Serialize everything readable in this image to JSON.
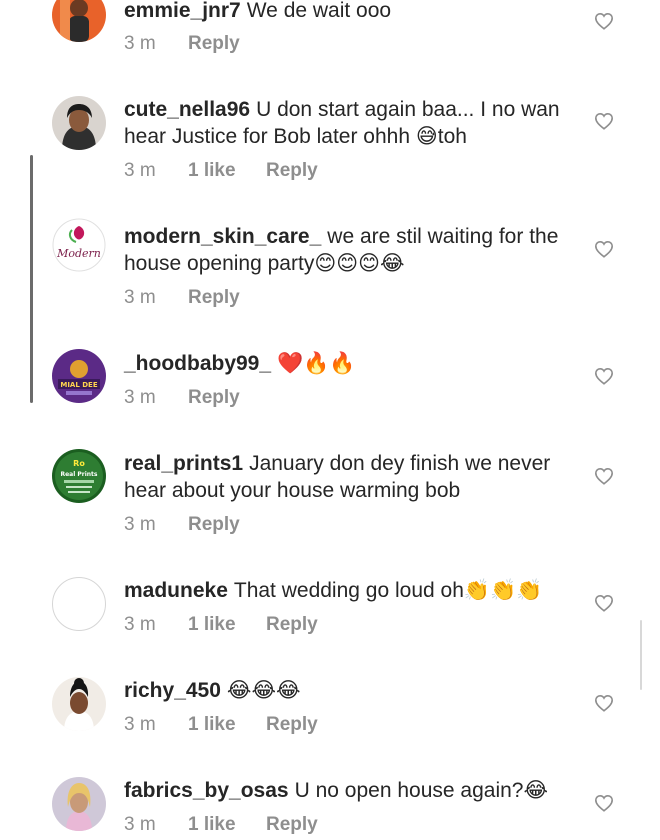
{
  "comments": [
    {
      "username": "emmie_jnr7",
      "text": "We de wait ooo",
      "time": "3 m",
      "likes": "",
      "reply": "Reply",
      "avatar": "orange-photo"
    },
    {
      "username": "cute_nella96",
      "text": "U don start again baa... I no wan hear Justice for Bob later ohhh 😅toh",
      "time": "3 m",
      "likes": "1 like",
      "reply": "Reply",
      "avatar": "woman-photo"
    },
    {
      "username": "modern_skin_care_",
      "text": "we are stil waiting for the house opening party😊😊😊😂",
      "time": "3 m",
      "likes": "",
      "reply": "Reply",
      "avatar": "modern-logo"
    },
    {
      "username": "_hoodbaby99_",
      "text": "❤️🔥🔥",
      "time": "3 m",
      "likes": "",
      "reply": "Reply",
      "avatar": "purple-badge"
    },
    {
      "username": "real_prints1",
      "text": "January don dey finish we never hear about your house warming bob",
      "time": "3 m",
      "likes": "",
      "reply": "Reply",
      "avatar": "real-prints-logo"
    },
    {
      "username": "maduneke",
      "text": "That wedding go loud oh👏👏👏",
      "time": "3 m",
      "likes": "1 like",
      "reply": "Reply",
      "avatar": "empty"
    },
    {
      "username": "richy_450",
      "text": "😂😂😂",
      "time": "3 m",
      "likes": "1 like",
      "reply": "Reply",
      "avatar": "woman-photo-2"
    },
    {
      "username": "fabrics_by_osas",
      "text": "U no open house again?😂",
      "time": "3 m",
      "likes": "1 like",
      "reply": "Reply",
      "avatar": "woman-photo-3"
    }
  ],
  "avatar_text": {
    "modern": "Modern",
    "real_prints_top": "Ro",
    "real_prints": "Real Prints",
    "hoodbaby": "MIAL DEE"
  },
  "icons": {
    "like": "heart-outline-icon"
  },
  "colors": {
    "text": "#262626",
    "meta": "#8e8e8e",
    "heart": "#8e8e8e"
  }
}
